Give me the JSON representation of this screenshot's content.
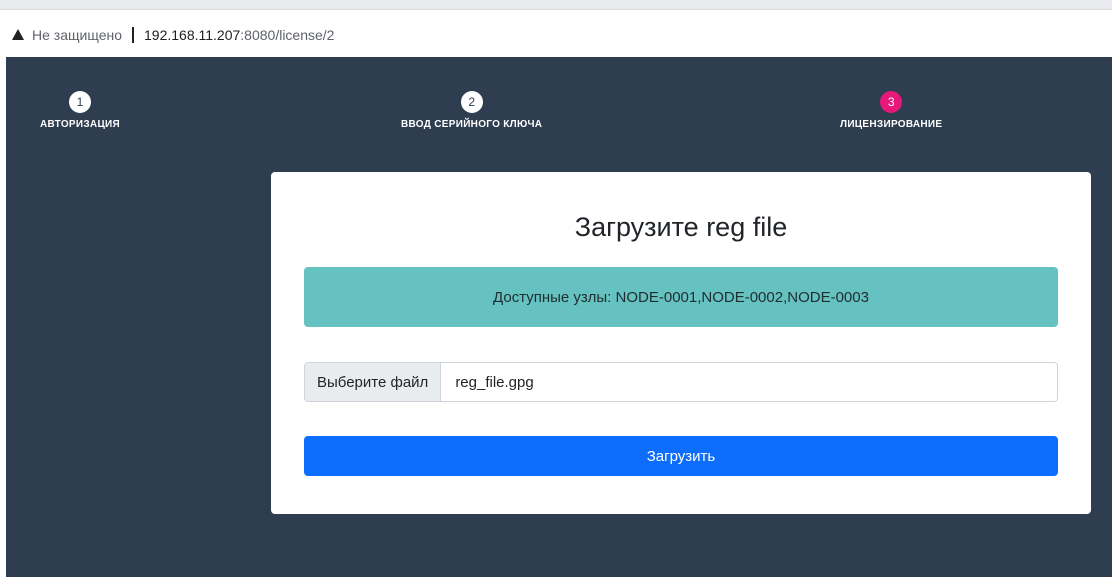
{
  "browser": {
    "security_label": "Не защищено",
    "url_host": "192.168.11.207",
    "url_rest": ":8080/license/2"
  },
  "steps": [
    {
      "number": "1",
      "label": "АВТОРИЗАЦИЯ",
      "active": false
    },
    {
      "number": "2",
      "label": "ВВОД СЕРИЙНОГО КЛЮЧА",
      "active": false
    },
    {
      "number": "3",
      "label": "ЛИЦЕНЗИРОВАНИЕ",
      "active": true
    }
  ],
  "card": {
    "title": "Загрузите reg file",
    "alert_text": "Доступные узлы: NODE-0001,NODE-0002,NODE-0003",
    "file_button_label": "Выберите файл",
    "file_name": "reg_file.gpg",
    "submit_label": "Загрузить"
  },
  "colors": {
    "background": "#2e3d4f",
    "active_step": "#e8177a",
    "alert": "#66c1c1",
    "primary": "#0d6efd"
  }
}
